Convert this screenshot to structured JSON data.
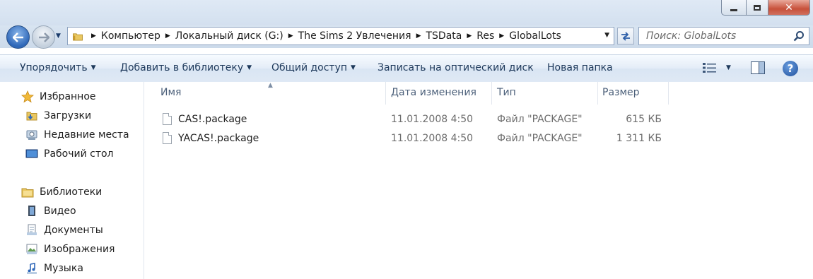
{
  "window": {
    "minimize_icon": "minimize-icon",
    "maximize_icon": "maximize-icon",
    "close_glyph": "✕"
  },
  "nav": {
    "back_icon": "back-arrow-icon",
    "forward_icon": "forward-arrow-icon",
    "breadcrumbs": [
      "Компьютер",
      "Локальный диск (G:)",
      "The Sims 2 Увлечения",
      "TSData",
      "Res",
      "GlobalLots"
    ],
    "search_placeholder": "Поиск: GlobalLots"
  },
  "toolbar": {
    "organize": "Упорядочить",
    "add_to_library": "Добавить в библиотеку",
    "share": "Общий доступ",
    "burn": "Записать на оптический диск",
    "new_folder": "Новая папка",
    "help": "?"
  },
  "sidebar": {
    "favorites": {
      "label": "Избранное",
      "items": [
        {
          "label": "Загрузки",
          "icon": "downloads-folder-icon"
        },
        {
          "label": "Недавние места",
          "icon": "recent-places-icon"
        },
        {
          "label": "Рабочий стол",
          "icon": "desktop-icon"
        }
      ]
    },
    "libraries": {
      "label": "Библиотеки",
      "items": [
        {
          "label": "Видео",
          "icon": "video-library-icon"
        },
        {
          "label": "Документы",
          "icon": "documents-library-icon"
        },
        {
          "label": "Изображения",
          "icon": "pictures-library-icon"
        },
        {
          "label": "Музыка",
          "icon": "music-library-icon"
        }
      ]
    }
  },
  "filelist": {
    "columns": {
      "name": "Имя",
      "date": "Дата изменения",
      "type": "Тип",
      "size": "Размер"
    },
    "files": [
      {
        "name": "CAS!.package",
        "date": "11.01.2008 4:50",
        "type": "Файл \"PACKAGE\"",
        "size": "615 КБ"
      },
      {
        "name": "YACAS!.package",
        "date": "11.01.2008 4:50",
        "type": "Файл \"PACKAGE\"",
        "size": "1 311 КБ"
      }
    ]
  },
  "colors": {
    "accent": "#2e67b8",
    "toolbar_text": "#1e395b",
    "close_button": "#c7503a"
  }
}
